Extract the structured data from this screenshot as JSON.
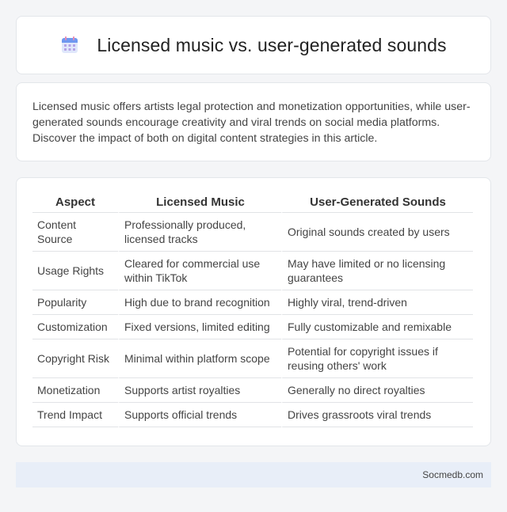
{
  "header": {
    "icon": "calendar-icon",
    "title": "Licensed music vs. user-generated sounds"
  },
  "intro": {
    "text": "Licensed music offers artists legal protection and monetization opportunities, while user-generated sounds encourage creativity and viral trends on social media platforms. Discover the impact of both on digital content strategies in this article."
  },
  "table": {
    "headers": [
      "Aspect",
      "Licensed Music",
      "User-Generated Sounds"
    ],
    "rows": [
      [
        "Content Source",
        "Professionally produced, licensed tracks",
        "Original sounds created by users"
      ],
      [
        "Usage Rights",
        "Cleared for commercial use within TikTok",
        "May have limited or no licensing guarantees"
      ],
      [
        "Popularity",
        "High due to brand recognition",
        "Highly viral, trend-driven"
      ],
      [
        "Customization",
        "Fixed versions, limited editing",
        "Fully customizable and remixable"
      ],
      [
        "Copyright Risk",
        "Minimal within platform scope",
        "Potential for copyright issues if reusing others' work"
      ],
      [
        "Monetization",
        "Supports artist royalties",
        "Generally no direct royalties"
      ],
      [
        "Trend Impact",
        "Supports official trends",
        "Drives grassroots viral trends"
      ]
    ]
  },
  "footer": {
    "site": "Socmedb.com"
  },
  "colors": {
    "background": "#f4f5f7",
    "card": "#ffffff",
    "footer_bg": "#e8eef8",
    "icon_blue": "#5b8def",
    "icon_pink": "#e58ab4"
  }
}
